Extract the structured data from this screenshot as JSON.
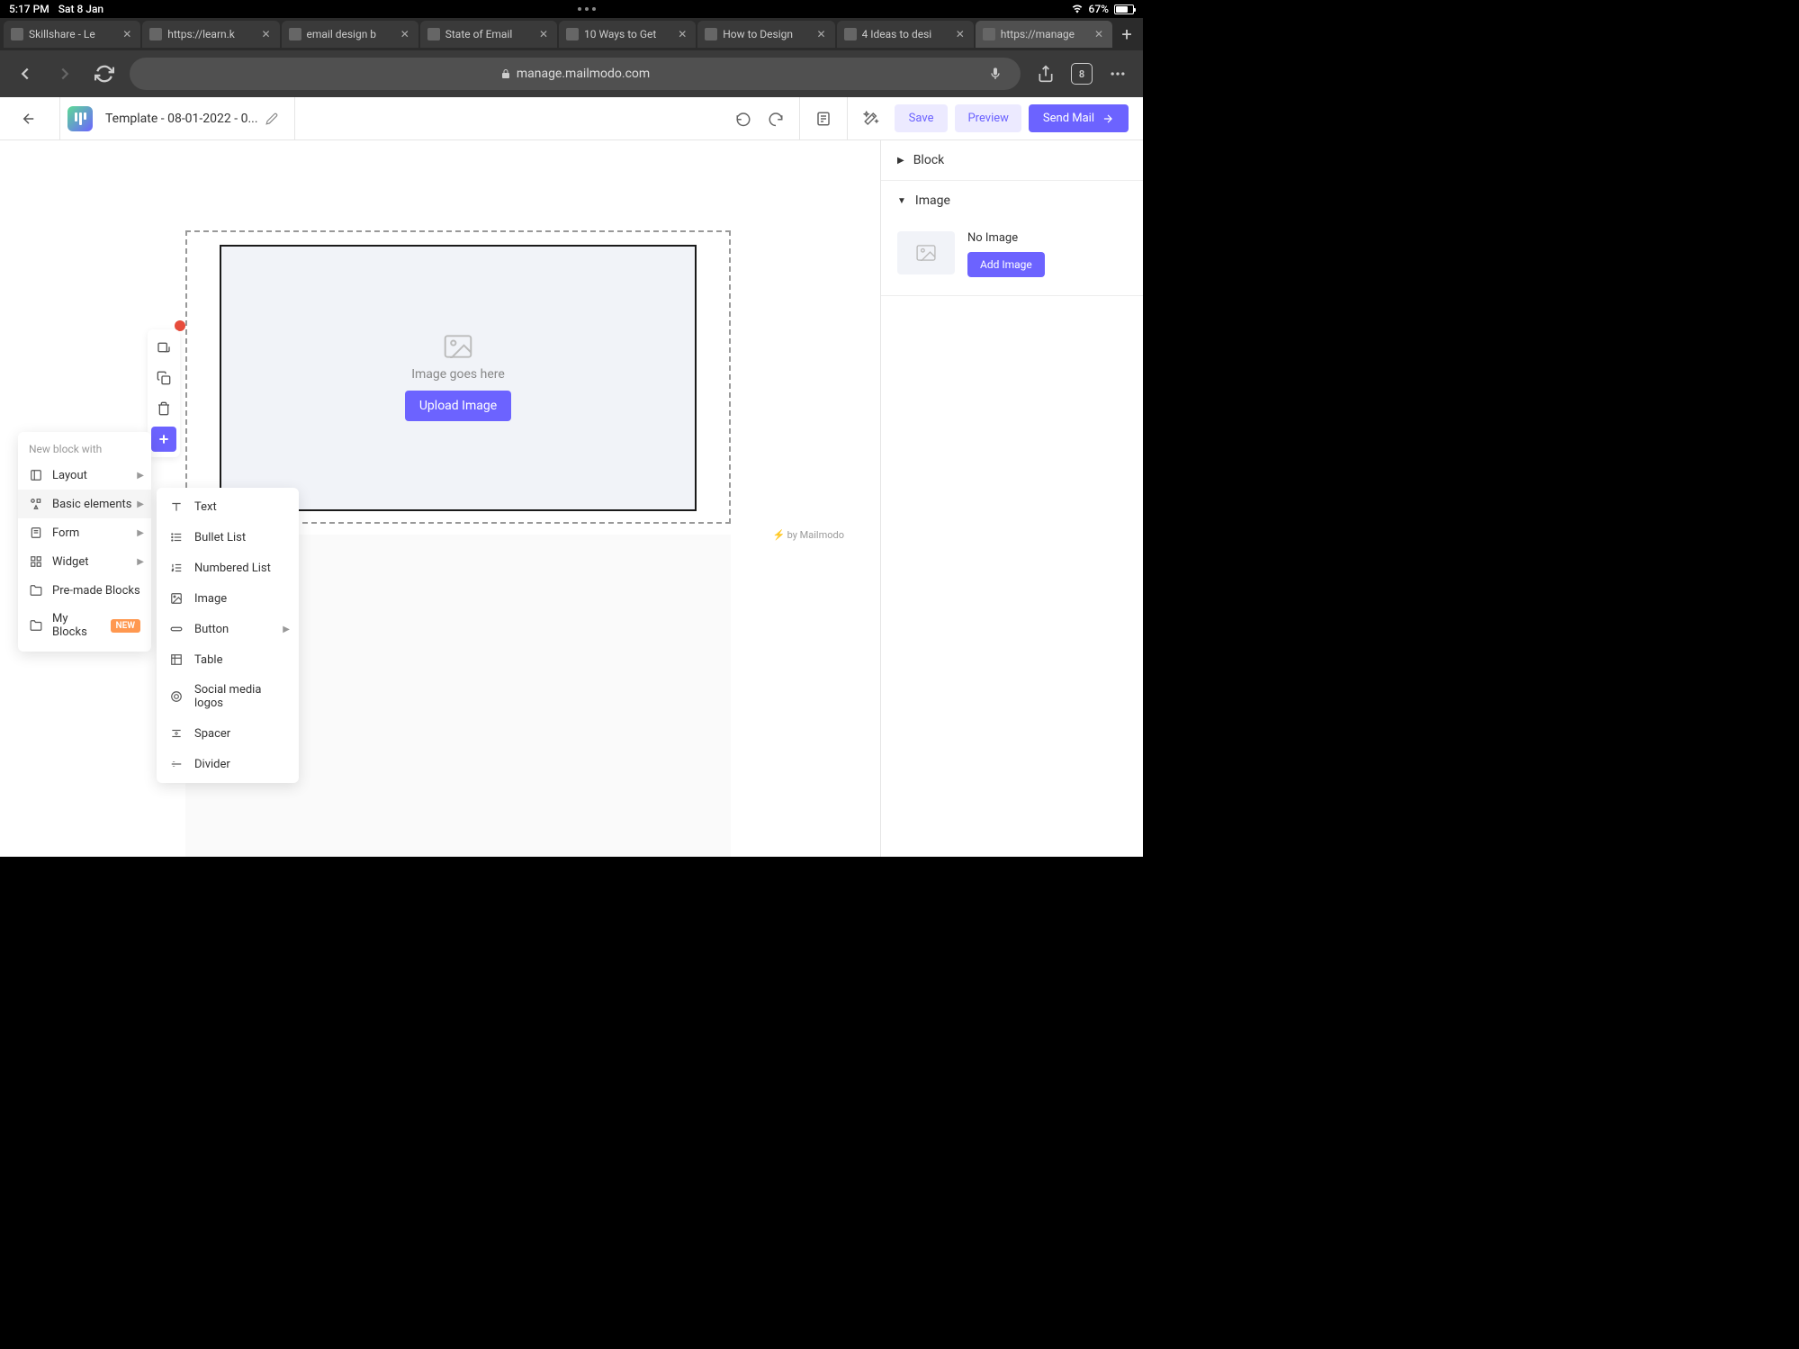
{
  "status": {
    "time": "5:17 PM",
    "date": "Sat 8 Jan",
    "battery": "67%"
  },
  "tabs": [
    {
      "title": "Skillshare - Le"
    },
    {
      "title": "https://learn.k"
    },
    {
      "title": "email design b"
    },
    {
      "title": "State of Email"
    },
    {
      "title": "10 Ways to Get"
    },
    {
      "title": "How to Design"
    },
    {
      "title": "4 Ideas to desi"
    },
    {
      "title": "https://manage"
    }
  ],
  "url": "manage.mailmodo.com",
  "tab_count": "8",
  "app_header": {
    "template_name": "Template - 08-01-2022 - 0...",
    "save": "Save",
    "preview": "Preview",
    "send": "Send Mail"
  },
  "canvas": {
    "placeholder_text": "Image goes here",
    "upload": "Upload Image",
    "powered_by": "by Mailmodo"
  },
  "block_menu": {
    "title": "New block with",
    "items": [
      {
        "label": "Layout",
        "has_sub": true
      },
      {
        "label": "Basic elements",
        "has_sub": true
      },
      {
        "label": "Form",
        "has_sub": true
      },
      {
        "label": "Widget",
        "has_sub": true
      },
      {
        "label": "Pre-made Blocks"
      },
      {
        "label": "My Blocks",
        "badge": "NEW"
      }
    ]
  },
  "submenu": {
    "items": [
      {
        "label": "Text"
      },
      {
        "label": "Bullet List"
      },
      {
        "label": "Numbered List"
      },
      {
        "label": "Image"
      },
      {
        "label": "Button",
        "has_sub": true
      },
      {
        "label": "Table"
      },
      {
        "label": "Social media logos"
      },
      {
        "label": "Spacer"
      },
      {
        "label": "Divider"
      }
    ]
  },
  "right_panel": {
    "block": "Block",
    "image": "Image",
    "no_image": "No Image",
    "add_image": "Add Image"
  }
}
